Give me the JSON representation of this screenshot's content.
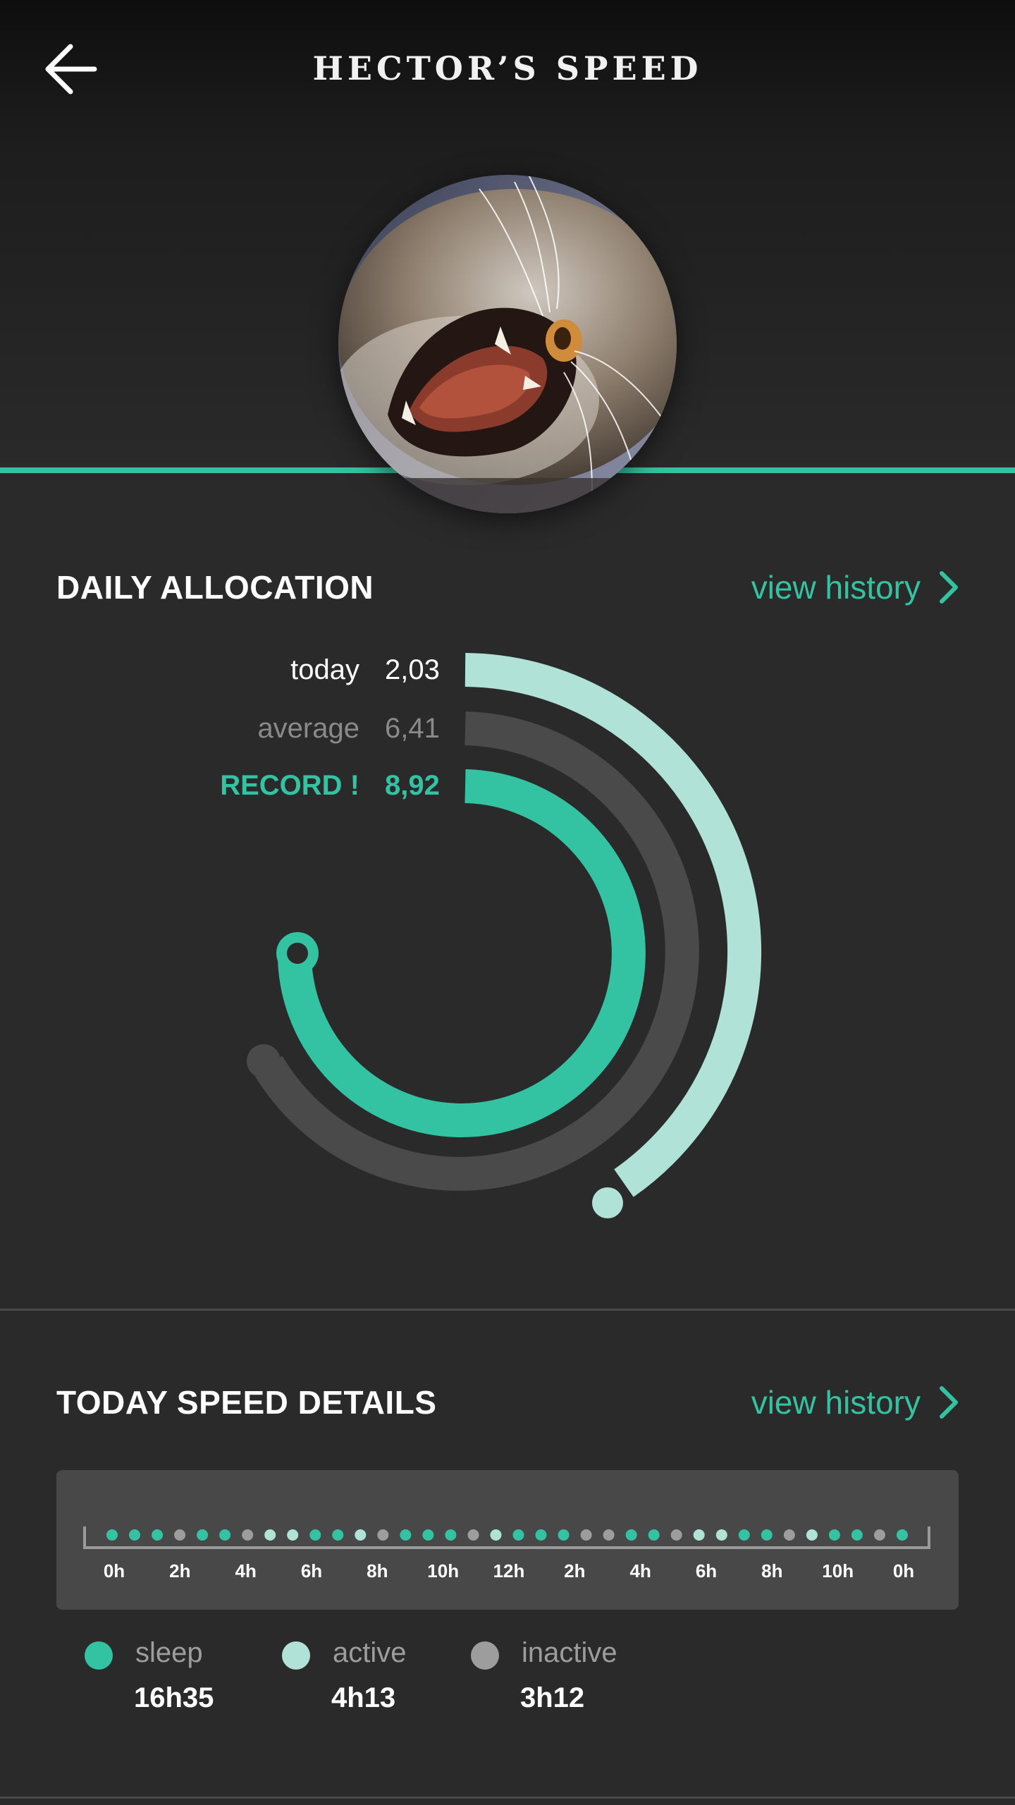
{
  "header": {
    "title": "HECTOR’S SPEED",
    "back_icon": "arrow-left-icon"
  },
  "colors": {
    "accent": "#33c3a2",
    "light_accent": "#b0e2d8",
    "gray": "#4a4a4a",
    "inactive": "#9d9d9d"
  },
  "daily_allocation": {
    "title": "DAILY ALLOCATION",
    "history_label": "view history",
    "stats": [
      {
        "label": "today",
        "value": "2,03"
      },
      {
        "label": "average",
        "value": "6,41"
      },
      {
        "label": "RECORD !",
        "value": "8,92"
      }
    ]
  },
  "speed_details": {
    "title": "TODAY SPEED DETAILS",
    "history_label": "view history",
    "hour_labels": [
      "0h",
      "2h",
      "4h",
      "6h",
      "8h",
      "10h",
      "12h",
      "2h",
      "4h",
      "6h",
      "8h",
      "10h",
      "0h"
    ],
    "timeline": [
      "s",
      "s",
      "s",
      "i",
      "s",
      "s",
      "i",
      "a",
      "a",
      "s",
      "s",
      "a",
      "i",
      "s",
      "s",
      "s",
      "i",
      "a",
      "s",
      "s",
      "s",
      "i",
      "i",
      "s",
      "s",
      "i",
      "a",
      "a",
      "s",
      "s",
      "i",
      "a",
      "s",
      "s",
      "i",
      "s"
    ],
    "legend": [
      {
        "label": "sleep",
        "value": "16h35",
        "color": "#33c3a2"
      },
      {
        "label": "active",
        "value": "4h13",
        "color": "#b0e2d8"
      },
      {
        "label": "inactive",
        "value": "3h12",
        "color": "#9d9d9d"
      }
    ]
  }
}
